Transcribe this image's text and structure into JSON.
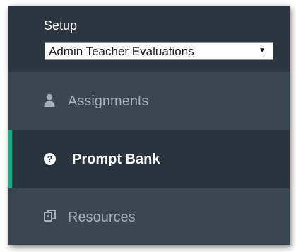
{
  "setup": {
    "label": "Setup",
    "select": {
      "selected": "Admin Teacher Evaluations"
    }
  },
  "nav": {
    "items": [
      {
        "label": "Assignments",
        "icon": "user-icon",
        "active": false
      },
      {
        "label": "Prompt Bank",
        "icon": "question-circle-icon",
        "active": true,
        "icon_glyph": "?"
      },
      {
        "label": "Resources",
        "icon": "copy-icon",
        "active": false
      }
    ]
  },
  "colors": {
    "panel": "#3a4651",
    "header": "#2b3640",
    "active_background": "#29333c",
    "active_accent": "#1aa88a",
    "inactive_text": "#a7b0b8",
    "active_text": "#ffffff"
  }
}
